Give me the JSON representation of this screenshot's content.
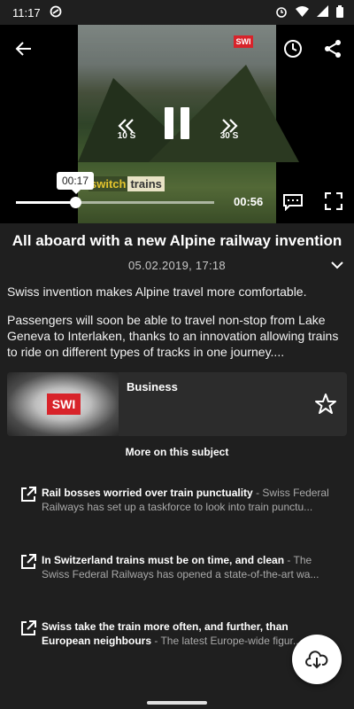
{
  "status_bar": {
    "time": "11:17"
  },
  "player": {
    "watermark": "SWI",
    "brand_part1": "switch",
    "brand_part2": "trains",
    "rewind_label": "10 S",
    "forward_label": "30 S",
    "current_time": "00:17",
    "duration": "00:56",
    "progress": 0.3
  },
  "article": {
    "title": "All aboard with a new Alpine railway invention",
    "date": "05.02.2019, 17:18",
    "summary_1": "Swiss invention makes Alpine travel more comfortable.",
    "summary_2": "Passengers will soon be able to travel non-stop from Lake Geneva to Interlaken, thanks to an innovation allowing trains to ride on different types of tracks in one journey...."
  },
  "category": {
    "name": "Business",
    "logo": "SWI"
  },
  "more": {
    "heading": "More on this subject",
    "items": [
      {
        "title": "Rail bosses worried over train punctuality",
        "desc": " - Swiss Federal Railways has set up a taskforce to look into train punctu..."
      },
      {
        "title": "In Switzerland trains must be on time, and clean",
        "desc": " - The Swiss Federal Railways has opened a state-of-the-art wa..."
      },
      {
        "title": "Swiss take the train more often, and further, than European neighbours",
        "desc": " - The latest Europe-wide figur..."
      }
    ]
  },
  "icons": {
    "back": "arrow-left",
    "history": "clock",
    "share": "share",
    "rewind": "double-chevron-left",
    "forward": "double-chevron-right",
    "pause": "pause",
    "subtitles": "closed-captions",
    "fullscreen": "fullscreen",
    "expand": "chevron-down",
    "favorite": "star-outline",
    "external": "external-link",
    "download": "cloud-download"
  }
}
